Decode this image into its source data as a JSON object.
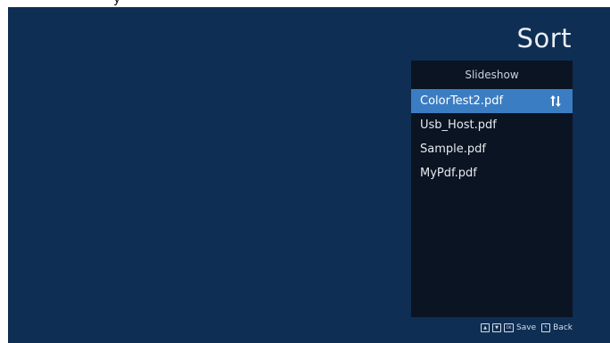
{
  "title": "Sort",
  "panel": {
    "header": "Slideshow",
    "files": [
      {
        "name": "ColorTest2.pdf",
        "selected": true
      },
      {
        "name": "Usb_Host.pdf",
        "selected": false
      },
      {
        "name": "Sample.pdf",
        "selected": false
      },
      {
        "name": "MyPdf.pdf",
        "selected": false
      }
    ],
    "selected_icon": "sort-up-down-icon"
  },
  "footer": {
    "up_key_glyph": "▲",
    "down_key_glyph": "▼",
    "ok_key_glyph": "OK",
    "save_label": "Save",
    "back_key_glyph": "↰",
    "back_label": "Back"
  },
  "colors": {
    "background": "#0f2e53",
    "panel": "#0b1422",
    "selection": "#3b7dc2"
  }
}
